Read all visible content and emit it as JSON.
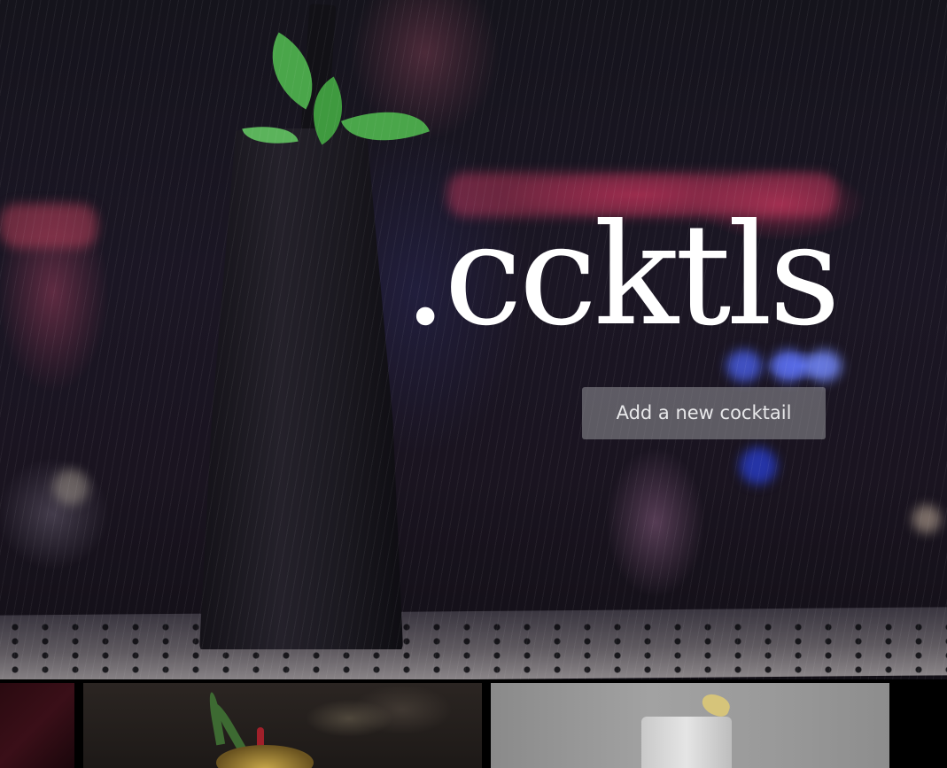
{
  "brand": {
    "title": ".ccktls"
  },
  "hero": {
    "cta_label": "Add a new cocktail"
  },
  "cards": [
    {
      "image": "cocktail-photo-dark-red"
    },
    {
      "image": "cocktail-photo-pineapple"
    },
    {
      "image": "cocktail-photo-white-lemon"
    }
  ],
  "colors": {
    "title": "#ffffff",
    "button_bg": "#96969b",
    "button_text": "#e8e8ea",
    "page_bg": "#000000"
  }
}
